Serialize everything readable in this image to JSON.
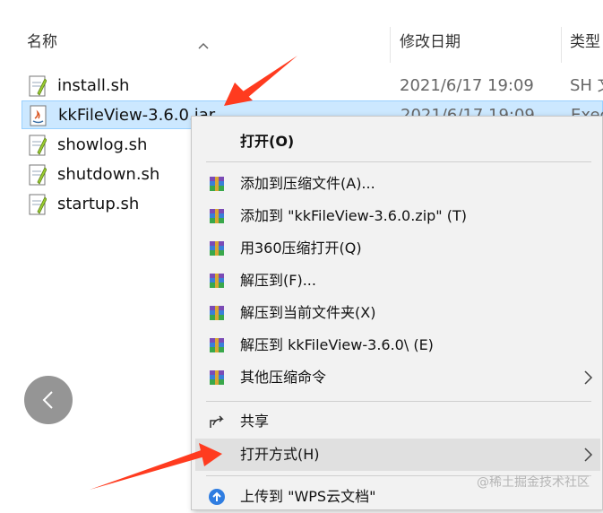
{
  "header": {
    "col_name": "名称",
    "col_date": "修改日期",
    "col_type": "类型"
  },
  "files": [
    {
      "name": "install.sh",
      "date": "2021/6/17 19:09",
      "type": "SH 文",
      "icon": "shell-script-icon"
    },
    {
      "name": "kkFileView-3.6.0.jar",
      "date": "2021/6/17 19:09",
      "type": "Exec",
      "icon": "jar-file-icon",
      "selected": true
    },
    {
      "name": "showlog.sh",
      "date": "",
      "type": "",
      "icon": "shell-script-icon"
    },
    {
      "name": "shutdown.sh",
      "date": "",
      "type": "",
      "icon": "shell-script-icon"
    },
    {
      "name": "startup.sh",
      "date": "",
      "type": "",
      "icon": "shell-script-icon"
    }
  ],
  "context_menu": {
    "open": "打开(O)",
    "add_archive": "添加到压缩文件(A)...",
    "add_zip": "添加到 \"kkFileView-3.6.0.zip\" (T)",
    "open_360": "用360压缩打开(Q)",
    "extract_to": "解压到(F)...",
    "extract_here": "解压到当前文件夹(X)",
    "extract_folder": "解压到 kkFileView-3.6.0\\ (E)",
    "other_commands": "其他压缩命令",
    "share": "共享",
    "open_with": "打开方式(H)",
    "upload_wps": "上传到 \"WPS云文档\""
  },
  "colors": {
    "selection": "#cce8ff",
    "menu_bg": "#f2f2f2",
    "arrow": "#ff3b1f"
  },
  "watermark": "@稀土掘金技术社区"
}
